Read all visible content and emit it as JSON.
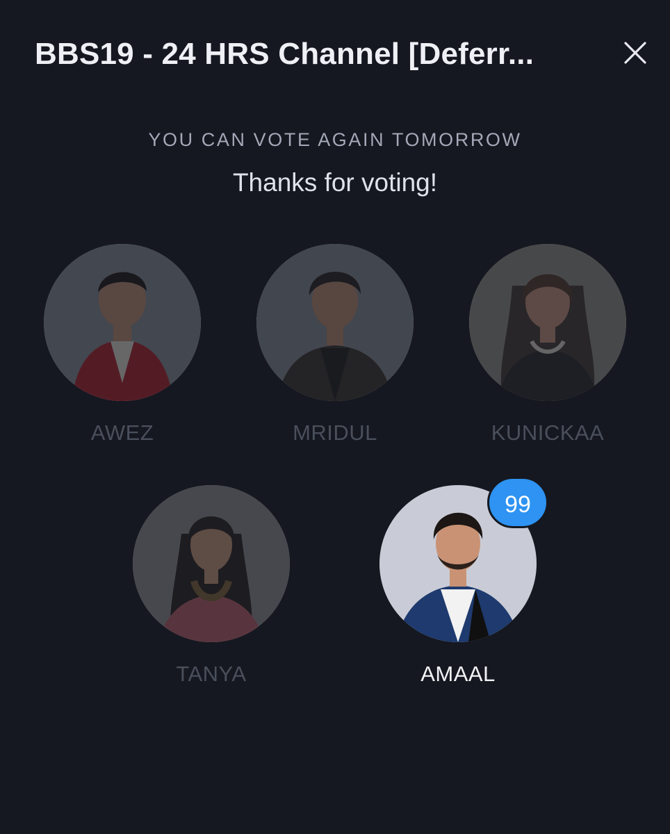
{
  "header": {
    "title": "BBS19 - 24 HRS Channel [Deferr...",
    "close_icon": "close-icon"
  },
  "status": {
    "subtitle": "YOU CAN VOTE AGAIN TOMORROW",
    "message": "Thanks for voting!"
  },
  "candidates": [
    {
      "name": "AWEZ",
      "voted": false,
      "accent": "#b8232e"
    },
    {
      "name": "MRIDUL",
      "voted": false,
      "accent": "#3d3530"
    },
    {
      "name": "KUNICKAA",
      "voted": false,
      "accent": "#4a3e37"
    },
    {
      "name": "TANYA",
      "voted": false,
      "accent": "#c4646e"
    },
    {
      "name": "AMAAL",
      "voted": true,
      "accent": "#1e3a6e",
      "votes": "99"
    }
  ],
  "colors": {
    "background": "#151820",
    "badge": "#2e93f2",
    "dimmed_text": "#4a4f5c",
    "active_text": "#f2f3f6"
  }
}
